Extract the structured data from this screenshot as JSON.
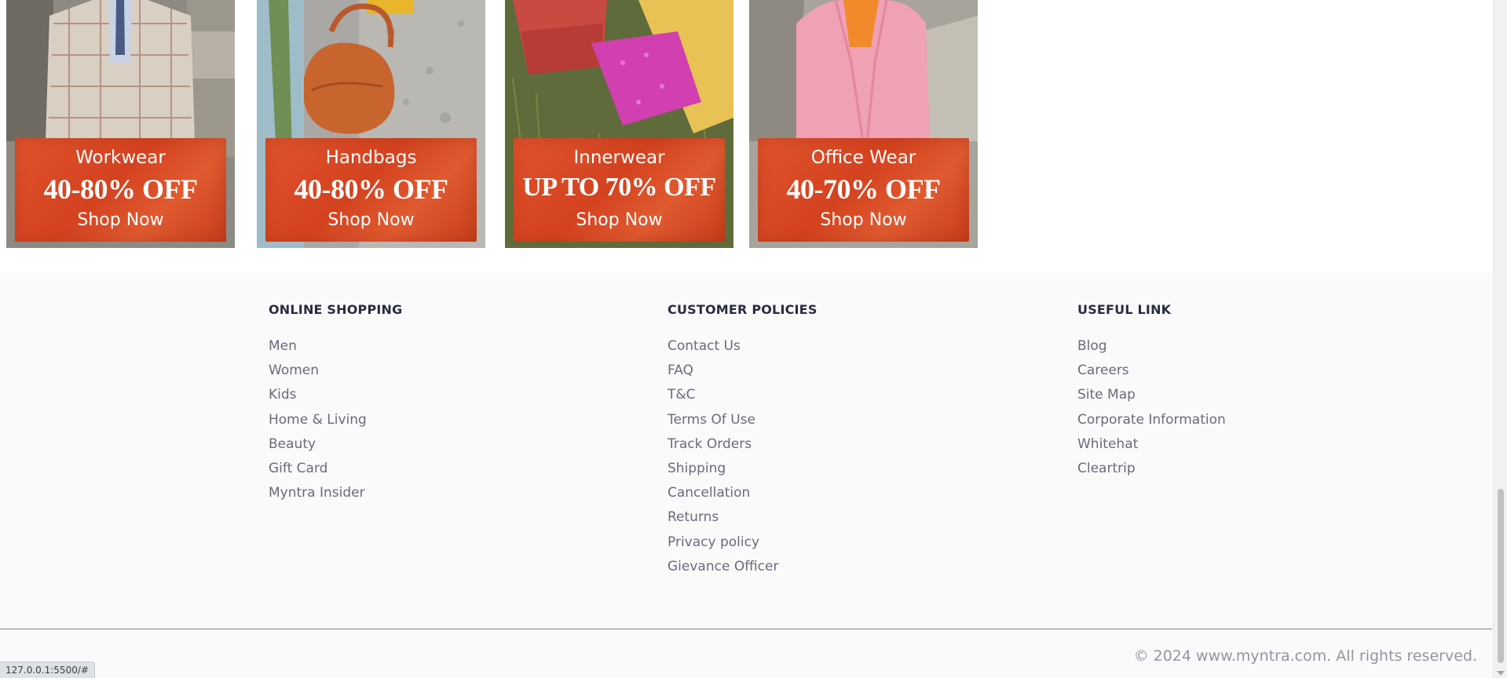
{
  "promos": [
    {
      "category": "Workwear",
      "discount": "40-80% OFF",
      "cta": "Shop Now"
    },
    {
      "category": "Handbags",
      "discount": "40-80% OFF",
      "cta": "Shop Now"
    },
    {
      "category": "Innerwear",
      "discount": "UP TO 70% OFF",
      "cta": "Shop Now"
    },
    {
      "category": "Office Wear",
      "discount": "40-70% OFF",
      "cta": "Shop Now"
    }
  ],
  "footer": {
    "columns": [
      {
        "heading": "ONLINE SHOPPING",
        "links": [
          "Men",
          "Women",
          "Kids",
          "Home & Living",
          "Beauty",
          "Gift Card",
          "Myntra Insider"
        ]
      },
      {
        "heading": "CUSTOMER POLICIES",
        "links": [
          "Contact Us",
          "FAQ",
          "T&C",
          "Terms Of Use",
          "Track Orders",
          "Shipping",
          "Cancellation",
          "Returns",
          "Privacy policy",
          "Gievance Officer"
        ]
      },
      {
        "heading": "USEFUL LINK",
        "links": [
          "Blog",
          "Careers",
          "Site Map",
          "Corporate Information",
          "Whitehat",
          "Cleartrip"
        ]
      }
    ],
    "copyright": "© 2024 www.myntra.com. All rights reserved."
  },
  "status_bar": {
    "url": "127.0.0.1:5500/#"
  },
  "colors": {
    "banner": "#d84a25",
    "heading": "#282c3f",
    "link": "#696b79",
    "footer_bg": "#fafafb"
  }
}
